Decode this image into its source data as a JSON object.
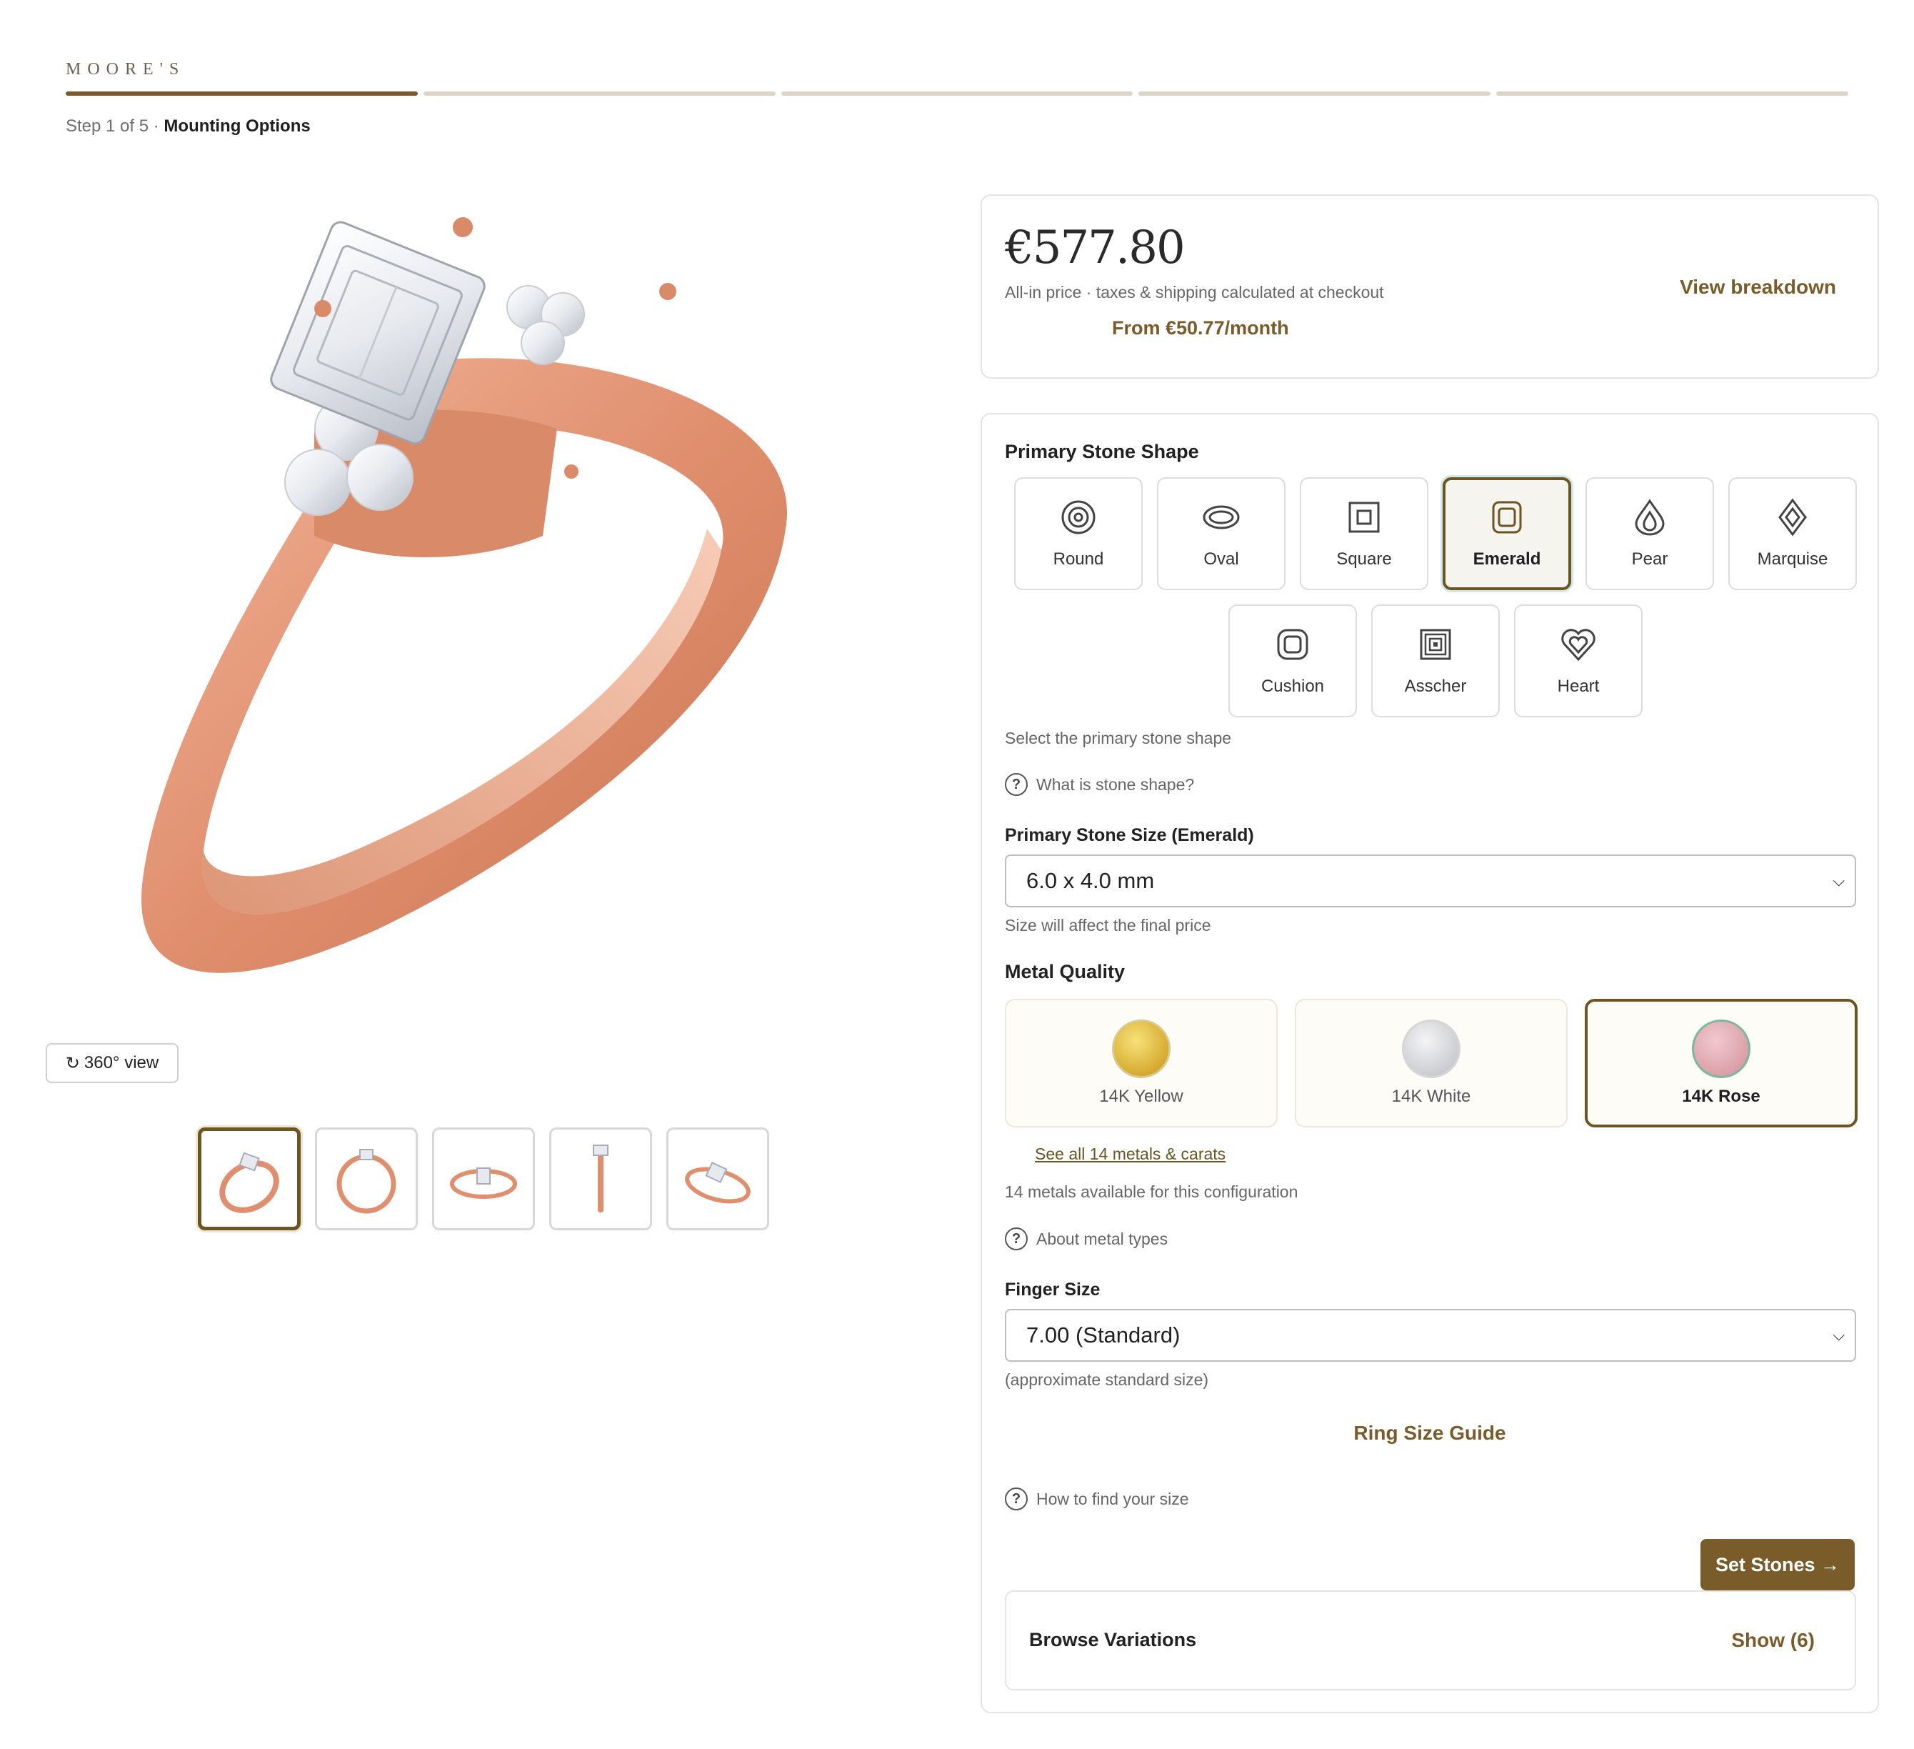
{
  "brand": "MOORE'S",
  "progress": {
    "current_step": 1,
    "total_steps": 5
  },
  "step": {
    "prefix": "Step 1 of 5 · ",
    "name": "Mounting Options"
  },
  "gallery": {
    "view360_label": "360° view",
    "thumbnails": [
      "thumb-angled",
      "thumb-front",
      "thumb-top",
      "thumb-side",
      "thumb-perspective"
    ],
    "selected_thumbnail": 0
  },
  "price": {
    "amount": "€577.80",
    "note": "All-in price · taxes & shipping calculated at checkout",
    "monthly": "From €50.77/month",
    "breakdown_link": "View breakdown"
  },
  "stone_shape": {
    "label": "Primary Stone Shape",
    "options": [
      "Round",
      "Oval",
      "Square",
      "Emerald",
      "Pear",
      "Marquise",
      "Cushion",
      "Asscher",
      "Heart"
    ],
    "selected": "Emerald",
    "hint": "Select the primary stone shape",
    "help": "What is stone shape?"
  },
  "stone_size": {
    "label": "Primary Stone Size (Emerald)",
    "value": "6.0 x 4.0 mm",
    "hint": "Size will affect the final price"
  },
  "metal": {
    "label": "Metal Quality",
    "options": [
      {
        "name": "14K Yellow",
        "color": "#d4a72c"
      },
      {
        "name": "14K White",
        "color": "#c7c8cc"
      },
      {
        "name": "14K Rose",
        "color": "#d89aa4"
      }
    ],
    "selected": "14K Rose",
    "see_all": "See all 14 metals & carats",
    "count_note": "14 metals available for this configuration",
    "help": "About metal types"
  },
  "finger_size": {
    "label": "Finger Size",
    "value": "7.00 (Standard)",
    "hint": "(approximate standard size)",
    "guide": "Ring Size Guide",
    "help": "How to find your size"
  },
  "cta": "Set Stones →",
  "variations": {
    "title": "Browse Variations",
    "show": "Show (6)"
  },
  "colors": {
    "accent": "#7a5c2a",
    "rose_gold": "#e59d7e"
  }
}
